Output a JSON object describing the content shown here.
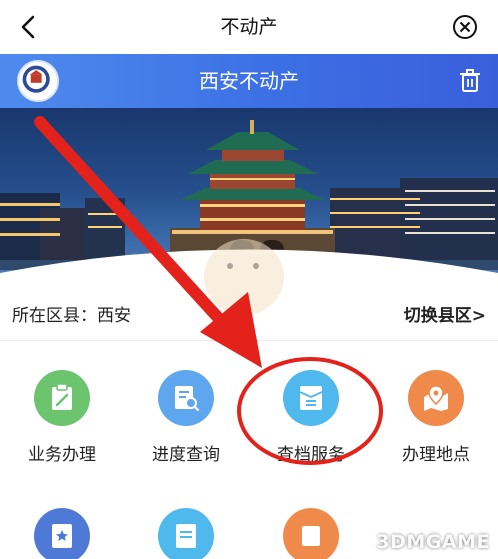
{
  "topbar": {
    "title": "不动产"
  },
  "header": {
    "title": "西安不动产"
  },
  "location": {
    "label": "所在区县：西安",
    "switch_label": "切换县区>"
  },
  "services": [
    {
      "label": "业务办理",
      "icon": "clipboard-edit-icon",
      "color": "#6cc46f"
    },
    {
      "label": "进度查询",
      "icon": "document-search-icon",
      "color": "#5ea7ee"
    },
    {
      "label": "查档服务",
      "icon": "folder-document-icon",
      "color": "#4fb8ec"
    },
    {
      "label": "办理地点",
      "icon": "map-pin-icon",
      "color": "#f08a4b"
    },
    {
      "label": "",
      "icon": "star-bookmark-icon",
      "color": "#4f79d6"
    },
    {
      "label": "",
      "icon": "document-icon",
      "color": "#4fb8ec"
    },
    {
      "label": "",
      "icon": "service-icon",
      "color": "#f08a4b"
    }
  ],
  "watermark": "3DMGAME",
  "colors": {
    "header_blue": "#3c6fe4",
    "annotation_red": "#e3231b"
  }
}
